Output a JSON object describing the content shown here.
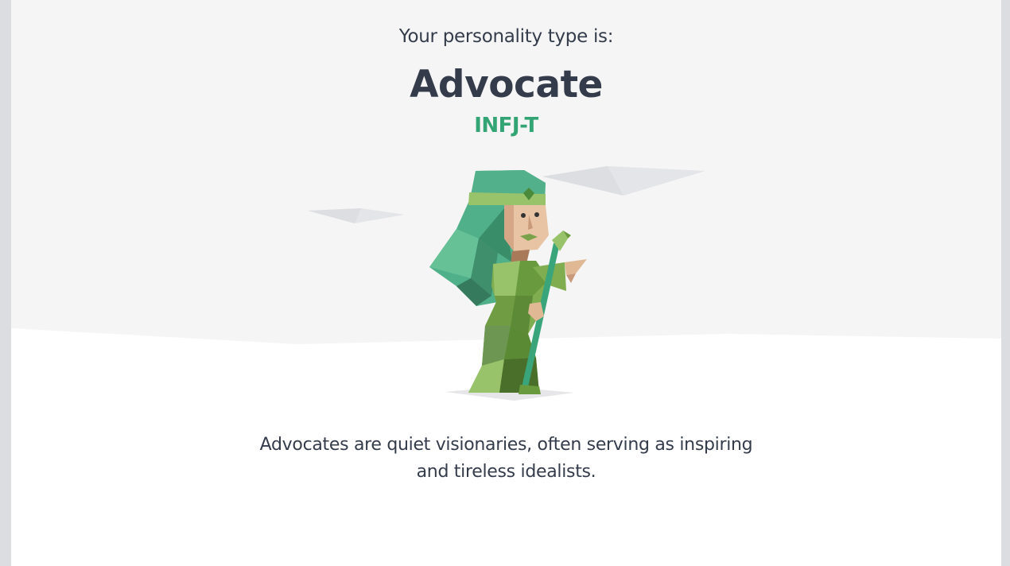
{
  "result": {
    "intro": "Your personality type is:",
    "type_name": "Advocate",
    "type_code": "INFJ-T",
    "description": "Advocates are quiet visionaries, often serving as inspiring and tireless idealists.",
    "illustration_icon": "advocate-character-icon"
  },
  "colors": {
    "accent": "#33a474",
    "heading": "#343c4b",
    "hero_background": "#f5f5f5"
  }
}
